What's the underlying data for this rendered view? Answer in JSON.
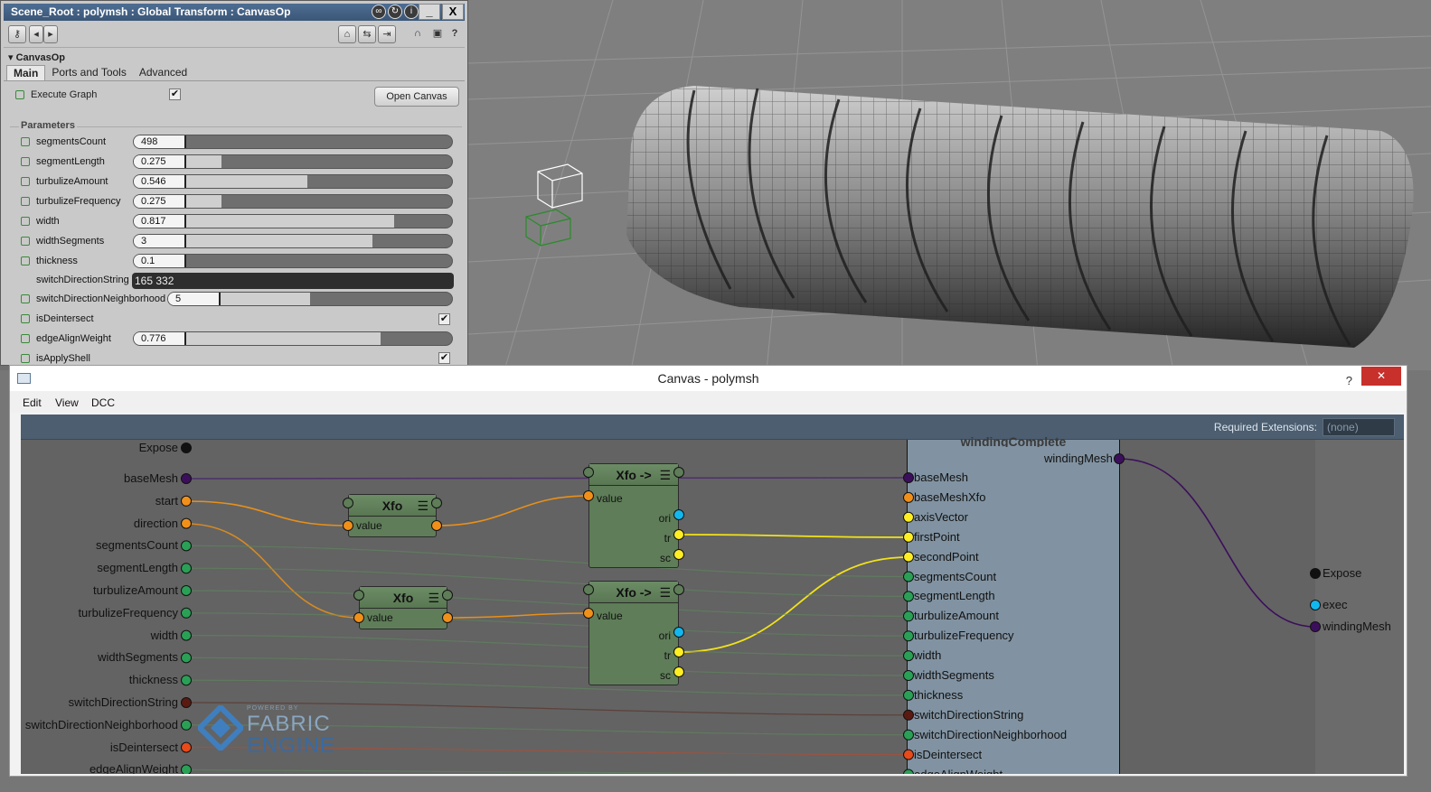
{
  "window_title": "Scene_Root : polymsh : Global Transform : CanvasOp",
  "title_buttons": {
    "minimize": "_",
    "close": "X"
  },
  "toolbar_help": "?",
  "section_title": "CanvasOp",
  "tabs": [
    "Main",
    "Ports and Tools",
    "Advanced"
  ],
  "execute_graph": {
    "label": "Execute Graph",
    "checked": "✔"
  },
  "open_canvas_label": "Open Canvas",
  "parameters_title": "Parameters",
  "params": [
    {
      "label": "segmentsCount",
      "value": "498",
      "fill": 0.0
    },
    {
      "label": "segmentLength",
      "value": "0.275",
      "fill": 0.275
    },
    {
      "label": "turbulizeAmount",
      "value": "0.546",
      "fill": 0.546
    },
    {
      "label": "turbulizeFrequency",
      "value": "0.275",
      "fill": 0.275
    },
    {
      "label": "width",
      "value": "0.817",
      "fill": 0.817
    },
    {
      "label": "widthSegments",
      "value": "3",
      "fill": 0.75
    },
    {
      "label": "thickness",
      "value": "0.1",
      "fill": 0.1
    }
  ],
  "switch_direction_string": {
    "label": "switchDirectionString",
    "value": "165 332"
  },
  "switch_direction_neighborhood": {
    "label": "switchDirectionNeighborhood",
    "value": "5",
    "fill": 0.5
  },
  "is_deintersect": {
    "label": "isDeintersect",
    "checked": "✔"
  },
  "edge_align_weight": {
    "label": "edgeAlignWeight",
    "value": "0.776",
    "fill": 0.776
  },
  "is_apply_shell": {
    "label": "isApplyShell",
    "checked": "✔"
  },
  "canvas_window": {
    "title": "Canvas - polymsh",
    "help": "?",
    "close": "✕",
    "menus": [
      "Edit",
      "View",
      "DCC"
    ],
    "required_extensions_label": "Required Extensions:",
    "required_extensions_value": "(none)"
  },
  "graph_inputs": {
    "expose": "Expose",
    "ports": [
      "baseMesh",
      "start",
      "direction",
      "segmentsCount",
      "segmentLength",
      "turbulizeAmount",
      "turbulizeFrequency",
      "width",
      "widthSegments",
      "thickness",
      "switchDirectionString",
      "switchDirectionNeighborhood",
      "isDeintersect",
      "edgeAlignWeight"
    ]
  },
  "xfo_nodes": [
    {
      "title": "Xfo",
      "port": "value"
    },
    {
      "title": "Xfo",
      "port": "value"
    }
  ],
  "xfo_decompose_nodes": [
    {
      "title": "Xfo ->",
      "input": "value",
      "outputs": [
        "ori",
        "tr",
        "sc"
      ]
    },
    {
      "title": "Xfo ->",
      "input": "value",
      "outputs": [
        "ori",
        "tr",
        "sc"
      ]
    }
  ],
  "node_menu_glyph": "☰",
  "winding_node": {
    "output": "windingMesh",
    "inputs": [
      "baseMesh",
      "baseMeshXfo",
      "axisVector",
      "firstPoint",
      "secondPoint",
      "segmentsCount",
      "segmentLength",
      "turbulizeAmount",
      "turbulizeFrequency",
      "width",
      "widthSegments",
      "thickness",
      "switchDirectionString",
      "switchDirectionNeighborhood",
      "isDeintersect",
      "edgeAlignWeight"
    ]
  },
  "graph_outputs": {
    "expose": "Expose",
    "ports": [
      "exec",
      "windingMesh"
    ]
  },
  "logo": {
    "powered_by": "POWERED BY",
    "line1": "FABRIC",
    "line2": "ENGINE"
  },
  "colors": {
    "port_purple": "#3c0f5c",
    "port_orange": "#f0901a",
    "port_green": "#2aa056",
    "port_dark_red": "#5a1a12",
    "port_red": "#e84a1a",
    "port_yellow": "#ffee22",
    "port_cyan": "#11b8ee",
    "wire_orange": "#e8901a",
    "wire_yellow": "#f2e21a"
  }
}
